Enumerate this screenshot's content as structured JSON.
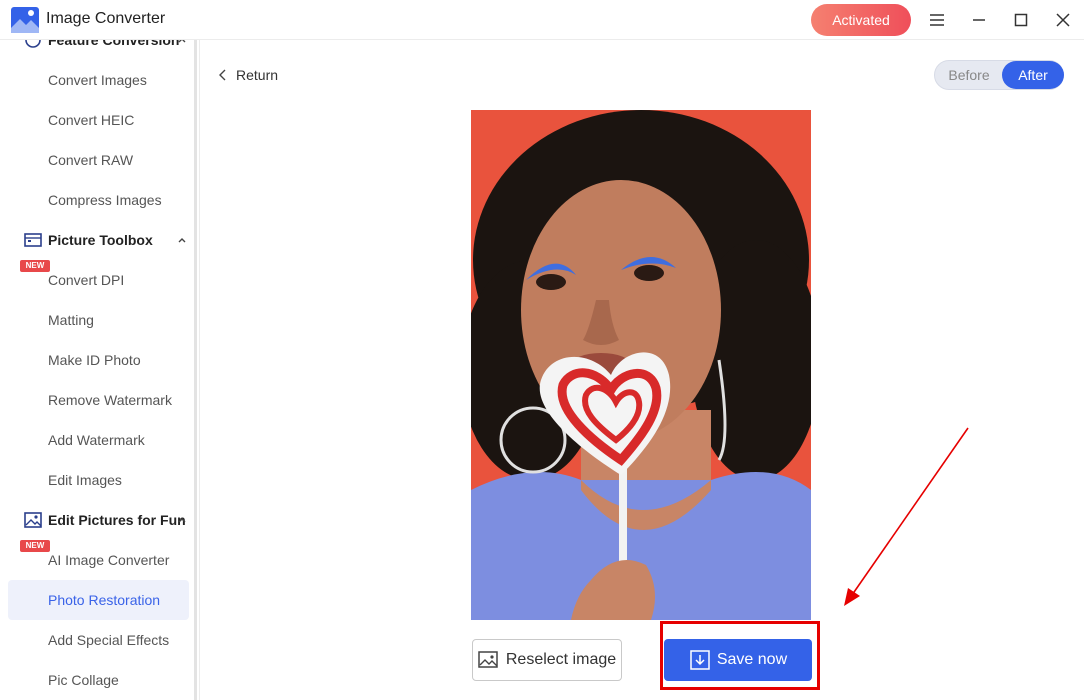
{
  "app": {
    "title": "Image Converter",
    "activated_label": "Activated"
  },
  "sidebar": {
    "group_feature": {
      "label": "Feature Conversion"
    },
    "group_toolbox": {
      "label": "Picture Toolbox"
    },
    "group_fun": {
      "label": "Edit Pictures for Fun"
    },
    "items": [
      {
        "label": "Convert Images"
      },
      {
        "label": "Convert HEIC"
      },
      {
        "label": "Convert RAW"
      },
      {
        "label": "Compress Images"
      },
      {
        "label": "Convert DPI"
      },
      {
        "label": "Matting"
      },
      {
        "label": "Make ID Photo"
      },
      {
        "label": "Remove Watermark"
      },
      {
        "label": "Add Watermark"
      },
      {
        "label": "Edit Images"
      },
      {
        "label": "AI Image Converter"
      },
      {
        "label": "Photo Restoration"
      },
      {
        "label": "Add Special Effects"
      },
      {
        "label": "Pic Collage"
      }
    ],
    "new_badge": "NEW",
    "active_item": "Photo Restoration"
  },
  "main": {
    "return_label": "Return",
    "toggle": {
      "before_label": "Before",
      "after_label": "After",
      "selected": "After"
    },
    "reselect_label": "Reselect image",
    "save_label": "Save now"
  },
  "colors": {
    "accent": "#3462e8",
    "activated": "#ef4f5a",
    "highlight": "#e60000",
    "photo_bg": "#e9533d"
  }
}
